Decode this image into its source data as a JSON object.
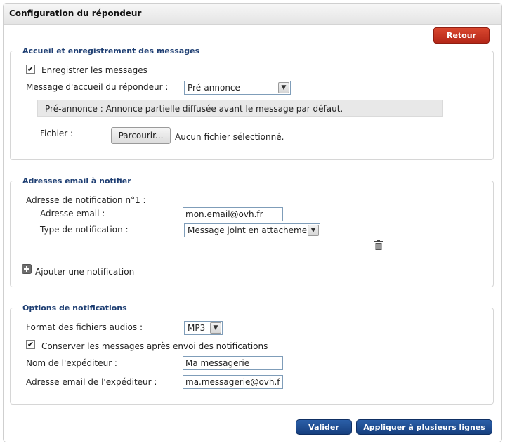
{
  "header": {
    "title": "Configuration du répondeur"
  },
  "buttons": {
    "back": "Retour",
    "validate": "Valider",
    "apply_multi": "Appliquer à plusieurs lignes"
  },
  "accueil": {
    "legend": "Accueil et enregistrement des messages",
    "record_label": "Enregistrer les messages",
    "record_checked": true,
    "greeting_label": "Message d'accueil du répondeur :",
    "greeting_value": "Pré-annonce",
    "info_text": "Pré-annonce : Annonce partielle diffusée avant le message par défaut.",
    "file_label": "Fichier :",
    "browse_label": "Parcourir...",
    "no_file_text": "Aucun fichier sélectionné."
  },
  "emails": {
    "legend": "Adresses email à notifier",
    "notif_title": "Adresse de notification n°1 :",
    "email_label": "Adresse email :",
    "email_value": "mon.email@ovh.fr",
    "type_label": "Type de notification :",
    "type_value": "Message joint en attachement",
    "add_label": "Ajouter une notification"
  },
  "options": {
    "legend": "Options de notifications",
    "format_label": "Format des fichiers audios :",
    "format_value": "MP3",
    "keep_label": "Conserver les messages après envoi des notifications",
    "keep_checked": true,
    "sender_name_label": "Nom de l'expéditeur :",
    "sender_name_value": "Ma messagerie",
    "sender_email_label": "Adresse email de l'expéditeur :",
    "sender_email_value": "ma.messagerie@ovh.fr"
  },
  "icons": {
    "check": "✔",
    "dropdown": "chevron-down-icon",
    "delete": "trash-icon",
    "add": "plus-icon"
  },
  "colors": {
    "legend_text": "#1f3f73",
    "back_button": "#c4331f",
    "action_button": "#1f4f93"
  }
}
